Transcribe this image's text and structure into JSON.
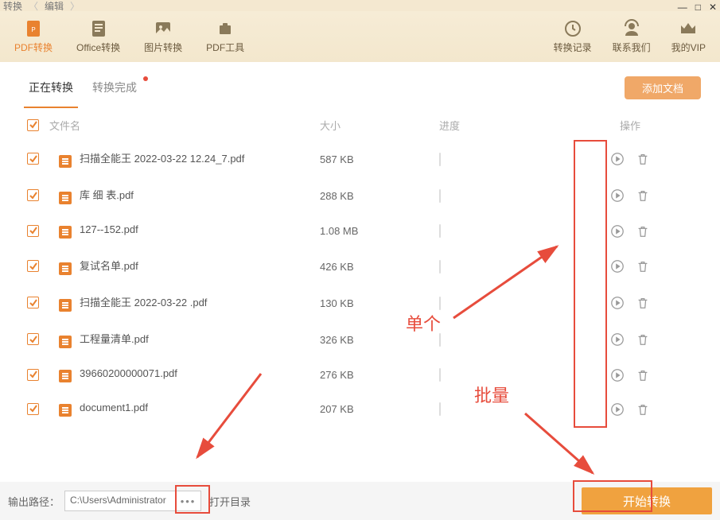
{
  "breadcrumb": {
    "item1": "转换",
    "item2": "编辑"
  },
  "toolbar": {
    "left": [
      {
        "label": "PDF转换",
        "icon": "pdf"
      },
      {
        "label": "Office转换",
        "icon": "doc"
      },
      {
        "label": "图片转换",
        "icon": "img"
      },
      {
        "label": "PDF工具",
        "icon": "tools"
      }
    ],
    "right": [
      {
        "label": "转换记录",
        "icon": "history"
      },
      {
        "label": "联系我们",
        "icon": "contact"
      },
      {
        "label": "我的VIP",
        "icon": "vip"
      }
    ]
  },
  "tabs": {
    "active": "正在转换",
    "second": "转换完成"
  },
  "addbtn": "添加文档",
  "listhead": {
    "name": "文件名",
    "size": "大小",
    "prog": "进度",
    "act": "操作"
  },
  "files": [
    {
      "name": "扫描全能王 2022-03-22 12.24_7.pdf",
      "size": "587 KB"
    },
    {
      "name": "库 细 表.pdf",
      "size": "288 KB"
    },
    {
      "name": "127--152.pdf",
      "size": "1.08 MB"
    },
    {
      "name": "复试名单.pdf",
      "size": "426 KB"
    },
    {
      "name": "扫描全能王 2022-03-22 .pdf",
      "size": "130 KB"
    },
    {
      "name": "工程量清单.pdf",
      "size": "326 KB"
    },
    {
      "name": "39660200000071.pdf",
      "size": "276 KB"
    },
    {
      "name": "document1.pdf",
      "size": "207 KB"
    }
  ],
  "footer": {
    "label": "输出路径：",
    "path": "C:\\Users\\Administrator",
    "open": "打开目录",
    "start": "开始转换"
  },
  "annotations": {
    "single": "单个",
    "batch": "批量"
  }
}
